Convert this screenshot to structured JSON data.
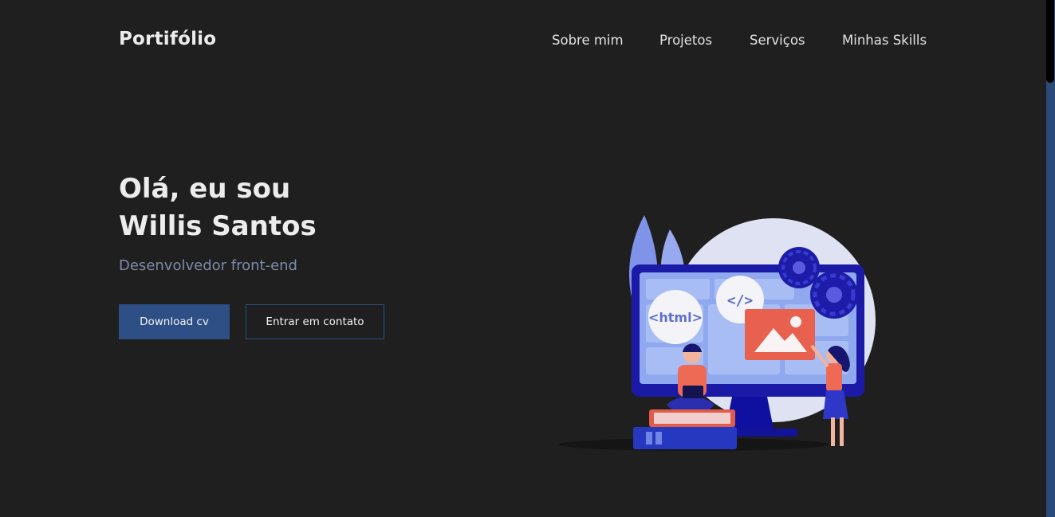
{
  "header": {
    "logo": "Portifólio",
    "nav": [
      "Sobre mim",
      "Projetos",
      "Serviços",
      "Minhas Skills"
    ]
  },
  "hero": {
    "title_line1": "Olá, eu sou",
    "title_line2": "Willis Santos",
    "subtitle": "Desenvolvedor front-end",
    "primary_button": "Download cv",
    "secondary_button": "Entrar em contato"
  },
  "illustration": {
    "html_tag": "<html>",
    "code_tag": "</>"
  },
  "colors": {
    "background": "#1f1f1f",
    "accent": "#2d4f86",
    "subtitle": "#7d8aa8"
  }
}
